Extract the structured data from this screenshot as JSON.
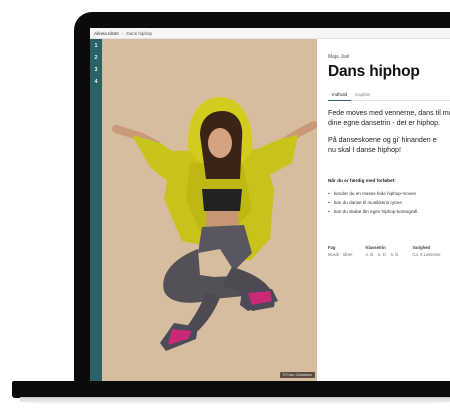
{
  "breadcrumb": {
    "home": "Alinea Idræt",
    "separator": "›",
    "current": "Dans hiphop"
  },
  "rail": {
    "items": [
      "1",
      "2",
      "3",
      "4"
    ],
    "color": "#2b6266"
  },
  "photo": {
    "credit": "© Foto: Colourbox",
    "background": "#d6bd9f"
  },
  "lesson": {
    "author": "Maja Juel",
    "title": "Dans hiphop",
    "tabs": [
      {
        "label": "Indhold",
        "active": true
      },
      {
        "label": "Kapitler",
        "active": false
      }
    ],
    "lead": [
      "Fede moves med vennerne, dans til mus",
      "dine egne dansetrin - det er hiphop.",
      "På danseskoene og gi' hinanden e",
      "nu skal I danse hiphop!"
    ],
    "goals_heading": "Når du er færdig med forløbet:",
    "goals": [
      "kender du en masse fede hiphop-moves",
      "kan du danse til musikkens rytme",
      "kan du skabe din egen hiphop-koreografi."
    ],
    "meta": [
      {
        "label": "Fag",
        "value": "Musik · Idræt"
      },
      {
        "label": "Klassetrin",
        "value": "4. kl. · 5. kl. · 6. kl."
      },
      {
        "label": "Varighed",
        "value": "Ca. 8 Lektioner"
      }
    ]
  }
}
